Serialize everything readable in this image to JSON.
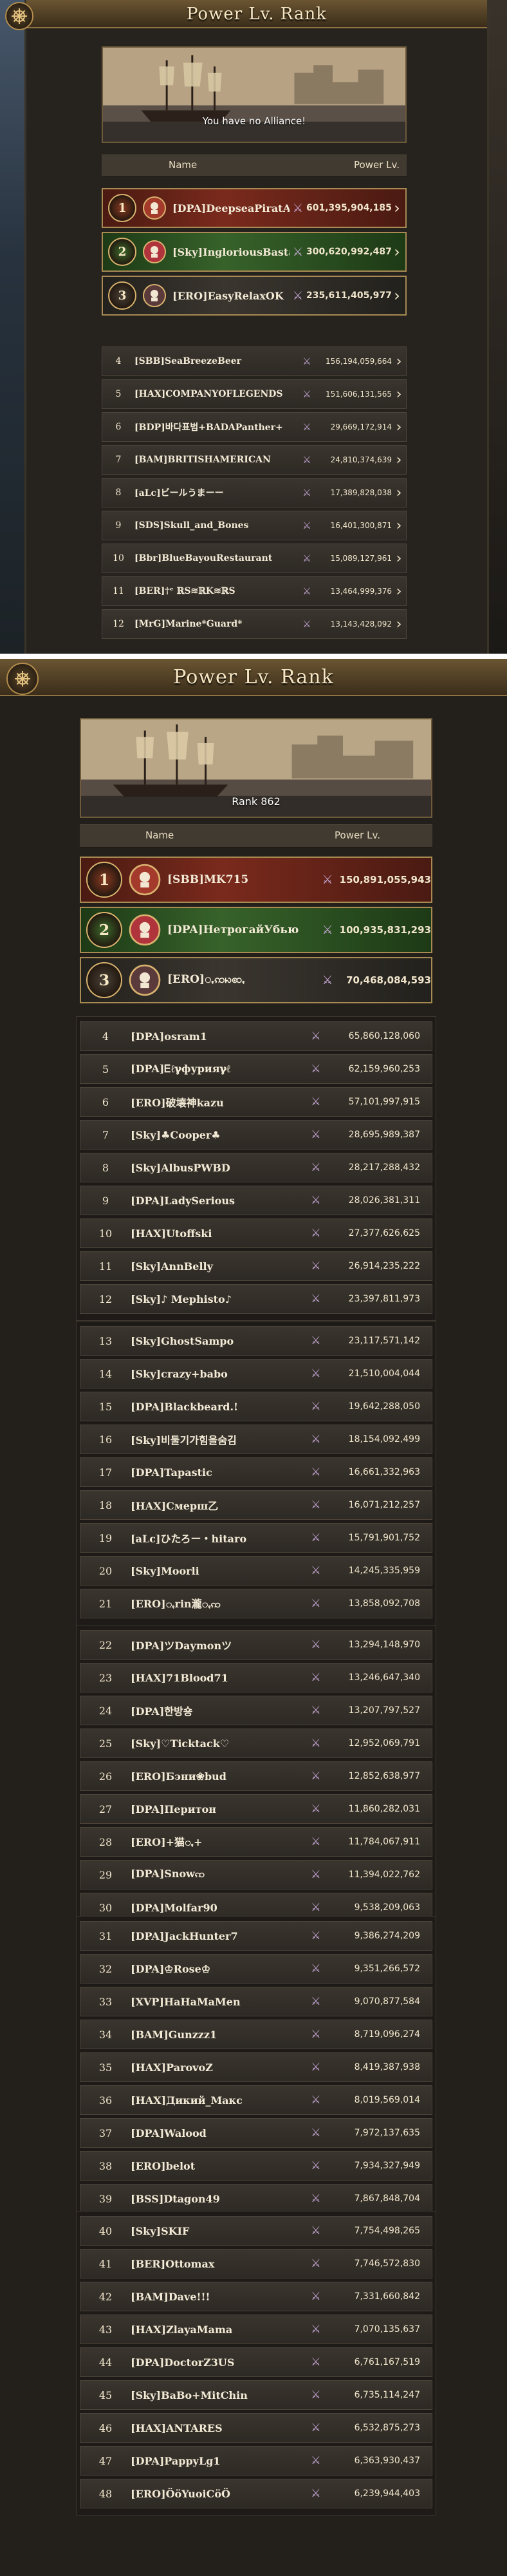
{
  "screen1": {
    "title": "Power Lv. Rank",
    "banner_caption": "You have no Alliance!",
    "col_name": "Name",
    "col_power": "Power Lv.",
    "top": [
      {
        "rank": "1",
        "name": "[DPA]DeepseaPiratAlliance",
        "power": "601,395,904,185"
      },
      {
        "rank": "2",
        "name": "[Sky]IngloriousBastards",
        "power": "300,620,992,487"
      },
      {
        "rank": "3",
        "name": "[ERO]EasyRelaxOK",
        "power": "235,611,405,977"
      }
    ],
    "rows": [
      {
        "rank": "4",
        "name": "[SBB]SeaBreezeBeer",
        "power": "156,194,059,664"
      },
      {
        "rank": "5",
        "name": "[HAX]COMPANYOFLEGENDS",
        "power": "151,606,131,565"
      },
      {
        "rank": "6",
        "name": "[BDP]바다표범+BADAPanther+",
        "power": "29,669,172,914"
      },
      {
        "rank": "7",
        "name": "[BAM]BRITISHAMERICAN",
        "power": "24,810,374,639"
      },
      {
        "rank": "8",
        "name": "[aLc]ビールうまーー",
        "power": "17,389,828,038"
      },
      {
        "rank": "9",
        "name": "[SDS]Skull_and_Bones",
        "power": "16,401,300,871"
      },
      {
        "rank": "10",
        "name": "[Bbr]BlueBayouRestaurant",
        "power": "15,089,127,961"
      },
      {
        "rank": "11",
        "name": "[BER]†ᵉ ℝS≋ℝK≋ℝS",
        "power": "13,464,999,376"
      },
      {
        "rank": "12",
        "name": "[MrG]Marine*Guard*",
        "power": "13,143,428,092"
      }
    ]
  },
  "screen2": {
    "title": "Power Lv. Rank",
    "banner_caption": "Rank 862",
    "col_name": "Name",
    "col_power": "Power Lv.",
    "top": [
      {
        "rank": "1",
        "name": "[SBB]MK715",
        "power": "150,891,055,943"
      },
      {
        "rank": "2",
        "name": "[DPA]НетрогайУбью",
        "power": "100,935,831,293"
      },
      {
        "rank": "3",
        "name": "[ERO]ꩻꩡꩢꩧꩻ",
        "power": "70,468,084,593"
      }
    ],
    "groups": [
      [
        {
          "rank": "4",
          "name": "[DPA]osram1",
          "power": "65,860,128,060"
        },
        {
          "rank": "5",
          "name": "[DPA]Ꭼℓℽфурияℽℓ",
          "power": "62,159,960,253"
        },
        {
          "rank": "6",
          "name": "[ERO]破壊神kazu",
          "power": "57,101,997,915"
        },
        {
          "rank": "7",
          "name": "[Sky]♣Cooper♣",
          "power": "28,695,989,387"
        },
        {
          "rank": "8",
          "name": "[Sky]AlbusPWBD",
          "power": "28,217,288,432"
        },
        {
          "rank": "9",
          "name": "[DPA]LadySerious",
          "power": "28,026,381,311"
        },
        {
          "rank": "10",
          "name": "[HAX]Utoffski",
          "power": "27,377,626,625"
        },
        {
          "rank": "11",
          "name": "[Sky]AnnBelly",
          "power": "26,914,235,222"
        },
        {
          "rank": "12",
          "name": "[Sky]♪ Mephisto♪",
          "power": "23,397,811,973"
        }
      ],
      [
        {
          "rank": "13",
          "name": "[Sky]GhostSampo",
          "power": "23,117,571,142"
        },
        {
          "rank": "14",
          "name": "[Sky]crazy+babo",
          "power": "21,510,004,044"
        },
        {
          "rank": "15",
          "name": "[DPA]Blackbeard.!",
          "power": "19,642,288,050"
        },
        {
          "rank": "16",
          "name": "[Sky]비둘기가힘을숨김",
          "power": "18,154,092,499"
        },
        {
          "rank": "17",
          "name": "[DPA]Tapastic",
          "power": "16,661,332,963"
        },
        {
          "rank": "18",
          "name": "[HAX]Смерш乙",
          "power": "16,071,212,257"
        },
        {
          "rank": "19",
          "name": "[aLc]ひたろー・hitaro",
          "power": "15,791,901,752"
        },
        {
          "rank": "20",
          "name": "[Sky]Moorli",
          "power": "14,245,335,959"
        },
        {
          "rank": "21",
          "name": "[ERO]ꩻrin瀧ꩻꩡ",
          "power": "13,858,092,708"
        }
      ],
      [
        {
          "rank": "22",
          "name": "[DPA]ツDaymonツ",
          "power": "13,294,148,970"
        },
        {
          "rank": "23",
          "name": "[HAX]71Blood71",
          "power": "13,246,647,340"
        },
        {
          "rank": "24",
          "name": "[DPA]한방숑",
          "power": "13,207,797,527"
        },
        {
          "rank": "25",
          "name": "[Sky]♡Ticktack♡",
          "power": "12,952,069,791"
        },
        {
          "rank": "26",
          "name": "[ERO]Бэни❀bud",
          "power": "12,852,638,977"
        },
        {
          "rank": "27",
          "name": "[DPA]Перитон",
          "power": "11,860,282,031"
        },
        {
          "rank": "28",
          "name": "[ERO]+猫ꩻ+",
          "power": "11,784,067,911"
        },
        {
          "rank": "29",
          "name": "[DPA]Snowꩡ",
          "power": "11,394,022,762"
        },
        {
          "rank": "30",
          "name": "[DPA]Molfar90",
          "power": "9,538,209,063"
        }
      ],
      [
        {
          "rank": "31",
          "name": "[DPA]JackHunter7",
          "power": "9,386,274,209"
        },
        {
          "rank": "32",
          "name": "[DPA]♔Rose♔",
          "power": "9,351,266,572"
        },
        {
          "rank": "33",
          "name": "[XVP]HaHaMaMen",
          "power": "9,070,877,584"
        },
        {
          "rank": "34",
          "name": "[BAM]Gunzzz1",
          "power": "8,719,096,274"
        },
        {
          "rank": "35",
          "name": "[HAX]ParovoZ",
          "power": "8,419,387,938"
        },
        {
          "rank": "36",
          "name": "[HAX]Дикий_Макс",
          "power": "8,019,569,014"
        },
        {
          "rank": "37",
          "name": "[DPA]Walood",
          "power": "7,972,137,635"
        },
        {
          "rank": "38",
          "name": "[ERO]belot",
          "power": "7,934,327,949"
        },
        {
          "rank": "39",
          "name": "[BSS]Dtagon49",
          "power": "7,867,848,704"
        }
      ],
      [
        {
          "rank": "40",
          "name": "[Sky]SKIF",
          "power": "7,754,498,265"
        },
        {
          "rank": "41",
          "name": "[BER]Ottomax",
          "power": "7,746,572,830"
        },
        {
          "rank": "42",
          "name": "[BAM]Dave!!!",
          "power": "7,331,660,842"
        },
        {
          "rank": "43",
          "name": "[HAX]ZlayaMama",
          "power": "7,070,135,637"
        },
        {
          "rank": "44",
          "name": "[DPA]DoctorZ3US",
          "power": "6,761,167,519"
        },
        {
          "rank": "45",
          "name": "[Sky]BaBo+MitChin",
          "power": "6,735,114,247"
        },
        {
          "rank": "46",
          "name": "[HAX]ANTARES",
          "power": "6,532,875,273"
        },
        {
          "rank": "47",
          "name": "[DPA]PappyLg1",
          "power": "6,363,930,437"
        },
        {
          "rank": "48",
          "name": "[ERO]ÖöYuoiCöÖ",
          "power": "6,239,944,403"
        }
      ]
    ]
  },
  "icons": {
    "back": "ship-wheel-icon",
    "swords": "crossed-swords-icon",
    "chevron": "chevron-right-icon"
  },
  "colors": {
    "gold": "#a88a52",
    "first": "#7a2a1c",
    "second": "#37622a",
    "third": "#3a352f"
  }
}
